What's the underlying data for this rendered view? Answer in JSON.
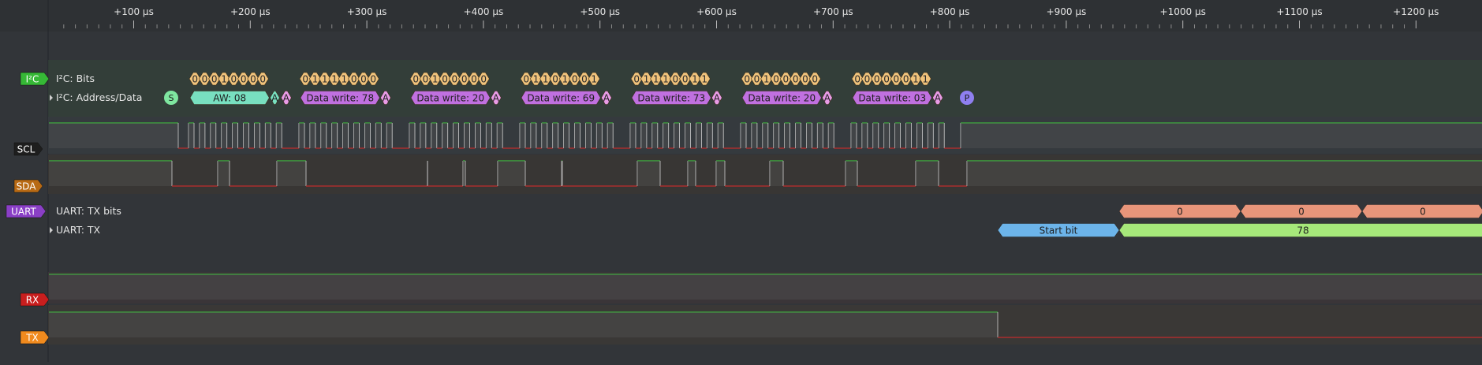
{
  "ruler": {
    "ticks": [
      "+100 µs",
      "+200 µs",
      "+300 µs",
      "+400 µs",
      "+500 µs",
      "+600 µs",
      "+700 µs",
      "+800 µs",
      "+900 µs",
      "+1000 µs",
      "+1100 µs",
      "+1200 µs"
    ]
  },
  "channels": [
    {
      "id": "i2c",
      "tag": "I²C",
      "color": "#36b836",
      "rows": [
        "I²C: Bits",
        "I²C: Address/Data"
      ]
    },
    {
      "id": "scl",
      "tag": "SCL",
      "color": "#1e1e1e"
    },
    {
      "id": "sda",
      "tag": "SDA",
      "color": "#b86a14"
    },
    {
      "id": "uart",
      "tag": "UART",
      "color": "#8a3fc6",
      "rows": [
        "UART: TX bits",
        "UART: TX"
      ]
    },
    {
      "id": "rx",
      "tag": "RX",
      "color": "#c81e1e"
    },
    {
      "id": "tx",
      "tag": "TX",
      "color": "#f08a1e"
    }
  ],
  "colors": {
    "bit": "#f0c37c",
    "addr": "#78e0c0",
    "data": "#c070e0",
    "ack": "#e89be6",
    "start": "#7fe6a0",
    "stop": "#8f7ff0",
    "uart_bit": "#e8957a",
    "uart_start": "#6cb4ea",
    "uart_data": "#a6e87a",
    "signal_high": "#3dbb3d",
    "signal_low": "#c02c2c"
  },
  "i2c": {
    "start_label": "S",
    "stop_label": "P",
    "bytes": [
      {
        "bits": "00010000",
        "label": "AW: 08",
        "ack": "A",
        "nack": "A",
        "kind": "addr"
      },
      {
        "bits": "01111000",
        "label": "Data write: 78",
        "ack": "A",
        "kind": "data"
      },
      {
        "bits": "00100000",
        "label": "Data write: 20",
        "ack": "A",
        "kind": "data"
      },
      {
        "bits": "01101001",
        "label": "Data write: 69",
        "ack": "A",
        "kind": "data"
      },
      {
        "bits": "01110011",
        "label": "Data write: 73",
        "ack": "A",
        "kind": "data"
      },
      {
        "bits": "00100000",
        "label": "Data write: 20",
        "ack": "A",
        "kind": "data"
      },
      {
        "bits": "00000011",
        "label": "Data write: 03",
        "ack": "A",
        "kind": "data"
      }
    ]
  },
  "uart": {
    "tx_bits": [
      "0",
      "0",
      "0"
    ],
    "start_label": "Start bit",
    "data_label": "78"
  }
}
